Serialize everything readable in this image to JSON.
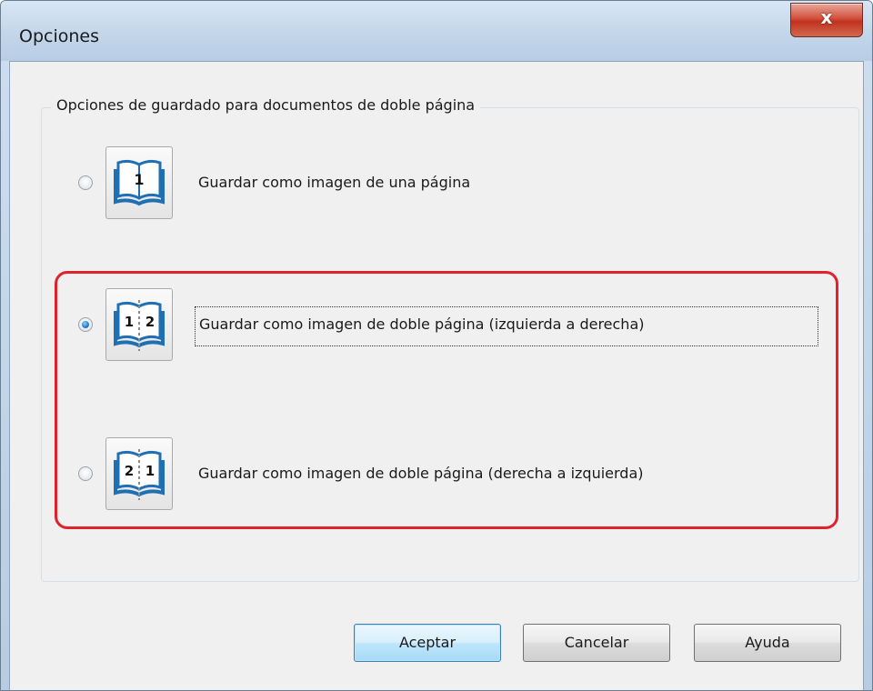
{
  "window": {
    "title": "Opciones",
    "close_label": "x"
  },
  "group": {
    "legend": "Opciones de guardado para documentos de doble página"
  },
  "options": [
    {
      "label": "Guardar como imagen de una página",
      "selected": false,
      "icon": "single-page-book-icon",
      "digits": [
        "1"
      ]
    },
    {
      "label": "Guardar como imagen de doble página (izquierda a derecha)",
      "selected": true,
      "icon": "double-page-left-to-right-book-icon",
      "digits": [
        "1",
        "2"
      ]
    },
    {
      "label": "Guardar como imagen de doble página (derecha a izquierda)",
      "selected": false,
      "icon": "double-page-right-to-left-book-icon",
      "digits": [
        "2",
        "1"
      ]
    }
  ],
  "buttons": {
    "ok": "Aceptar",
    "cancel": "Cancelar",
    "help": "Ayuda"
  },
  "colors": {
    "highlight": "#e3212b",
    "book_blue": "#1f6fb5"
  }
}
